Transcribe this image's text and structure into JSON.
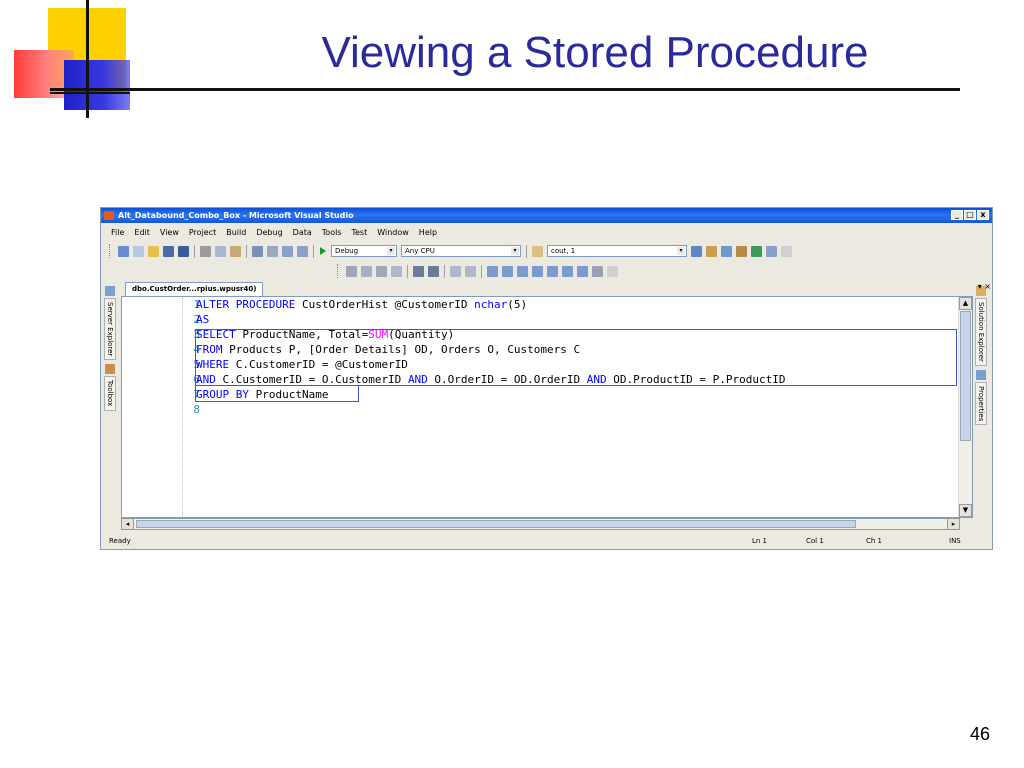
{
  "slide": {
    "title": "Viewing a Stored Procedure",
    "page_number": "46"
  },
  "window": {
    "title": "Alt_Databound_Combo_Box - Microsoft Visual Studio",
    "controls": [
      "_",
      "□",
      "x"
    ]
  },
  "menu": [
    "File",
    "Edit",
    "View",
    "Project",
    "Build",
    "Debug",
    "Data",
    "Tools",
    "Test",
    "Window",
    "Help"
  ],
  "toolbar": {
    "config_combo": "Debug",
    "platform_combo": "Any CPU",
    "find_combo": "cout, 1"
  },
  "document_tab": {
    "label": "dbo.CustOrder...rpius.wpusr40)",
    "controls": "▾ ×"
  },
  "side_panels": {
    "left": [
      "Server Explorer",
      "Toolbox"
    ],
    "right": [
      "Solution Explorer",
      "Properties"
    ]
  },
  "code": {
    "line_numbers": [
      "1",
      "2",
      "3",
      "4",
      "5",
      "6",
      "7",
      "8"
    ],
    "lines": [
      [
        {
          "t": "ALTER PROCEDURE",
          "c": "kw"
        },
        {
          "t": " CustOrderHist @CustomerID ",
          "c": ""
        },
        {
          "t": "nchar",
          "c": "kw"
        },
        {
          "t": "(5)",
          "c": ""
        }
      ],
      [
        {
          "t": "AS",
          "c": "kw"
        }
      ],
      [
        {
          "t": "SELECT",
          "c": "kw"
        },
        {
          "t": " ProductName, Total=",
          "c": ""
        },
        {
          "t": "SUM",
          "c": "fn"
        },
        {
          "t": "(Quantity)",
          "c": ""
        }
      ],
      [
        {
          "t": "FROM",
          "c": "kw"
        },
        {
          "t": " Products P, [Order Details] OD, Orders O, Customers C",
          "c": ""
        }
      ],
      [
        {
          "t": "WHERE",
          "c": "kw"
        },
        {
          "t": " C.CustomerID = @CustomerID",
          "c": ""
        }
      ],
      [
        {
          "t": "AND",
          "c": "kw"
        },
        {
          "t": " C.CustomerID = O.CustomerID ",
          "c": ""
        },
        {
          "t": "AND",
          "c": "kw"
        },
        {
          "t": " O.OrderID = OD.OrderID ",
          "c": ""
        },
        {
          "t": "AND",
          "c": "kw"
        },
        {
          "t": " OD.ProductID = P.ProductID",
          "c": ""
        }
      ],
      [
        {
          "t": "GROUP BY",
          "c": "kw"
        },
        {
          "t": " ProductName",
          "c": ""
        }
      ],
      []
    ]
  },
  "status": {
    "ready": "Ready",
    "line": "Ln 1",
    "col": "Col 1",
    "ch": "Ch 1",
    "mode": "INS"
  },
  "colors": {
    "keyword": "#0000ff",
    "function": "#ff00ff",
    "line_number": "#2b91af",
    "title_text": "#2a2a9a"
  }
}
